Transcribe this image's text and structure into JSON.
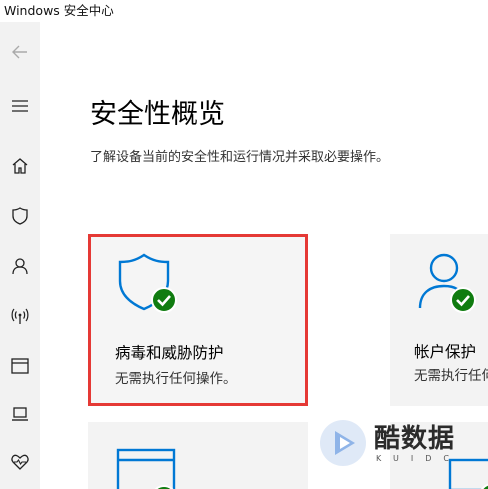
{
  "window": {
    "title": "Windows 安全中心"
  },
  "sidebar": {
    "items": [
      {
        "name": "back",
        "icon": "back-arrow-icon"
      },
      {
        "name": "menu",
        "icon": "hamburger-icon"
      },
      {
        "name": "home",
        "icon": "home-icon"
      },
      {
        "name": "virus-protection",
        "icon": "shield-icon"
      },
      {
        "name": "account-protection",
        "icon": "person-icon"
      },
      {
        "name": "firewall-network",
        "icon": "wireless-icon"
      },
      {
        "name": "app-browser-control",
        "icon": "browser-window-icon"
      },
      {
        "name": "device-security",
        "icon": "laptop-icon"
      },
      {
        "name": "device-performance",
        "icon": "heart-pulse-icon"
      }
    ]
  },
  "main": {
    "title": "安全性概览",
    "subtitle": "了解设备当前的安全性和运行情况并采取必要操作。",
    "cards": [
      {
        "title": "病毒和威胁防护",
        "status": "无需执行任何操作。",
        "icon": "shield-check-icon",
        "highlighted": true
      },
      {
        "title": "帐户保护",
        "status": "无需执行任何操作。",
        "icon": "person-check-icon",
        "highlighted": false
      },
      {
        "title": "",
        "status": "",
        "icon": "browser-check-icon",
        "highlighted": false
      },
      {
        "title": "",
        "status": "",
        "icon": "device-check-icon",
        "highlighted": false
      }
    ]
  },
  "watermark": {
    "text": "酷数据",
    "sub": "KUIDC"
  },
  "colors": {
    "accent": "#0078d4",
    "ok": "#107c10",
    "highlight": "#e53935",
    "sidebar": "#f2f2f2"
  }
}
